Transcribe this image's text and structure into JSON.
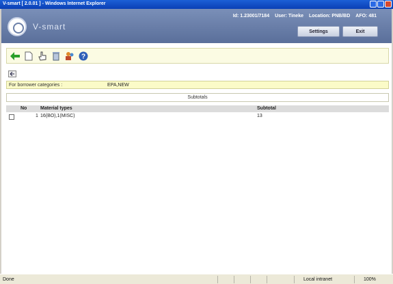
{
  "window": {
    "title": "V-smart [ 2.0.01 ] - Windows Internet Explorer"
  },
  "header": {
    "logo_text": "V-smart",
    "id": "Id: 1.23001/7184",
    "user": "User: Tineke",
    "location": "Location: PNB/BD",
    "afo": "AFO: 481",
    "settings_label": "Settings",
    "exit_label": "Exit"
  },
  "toolbar": {
    "icons": [
      "back-arrow-icon",
      "new-document-icon",
      "hand-pointer-icon",
      "trash-icon",
      "people-icon",
      "help-icon"
    ]
  },
  "filter": {
    "label": "For borrower categories :",
    "value": "EPA,NEW"
  },
  "section": {
    "title": "Subtotals"
  },
  "table": {
    "headers": {
      "no": "No",
      "material_types": "Material types",
      "subtotal": "Subtotal"
    },
    "rows": [
      {
        "no": "1",
        "material_types": "16(BO),1(MISC)",
        "subtotal": "13"
      }
    ]
  },
  "status": {
    "left": "Done",
    "zone": "Local intranet",
    "zoom": "100%"
  }
}
